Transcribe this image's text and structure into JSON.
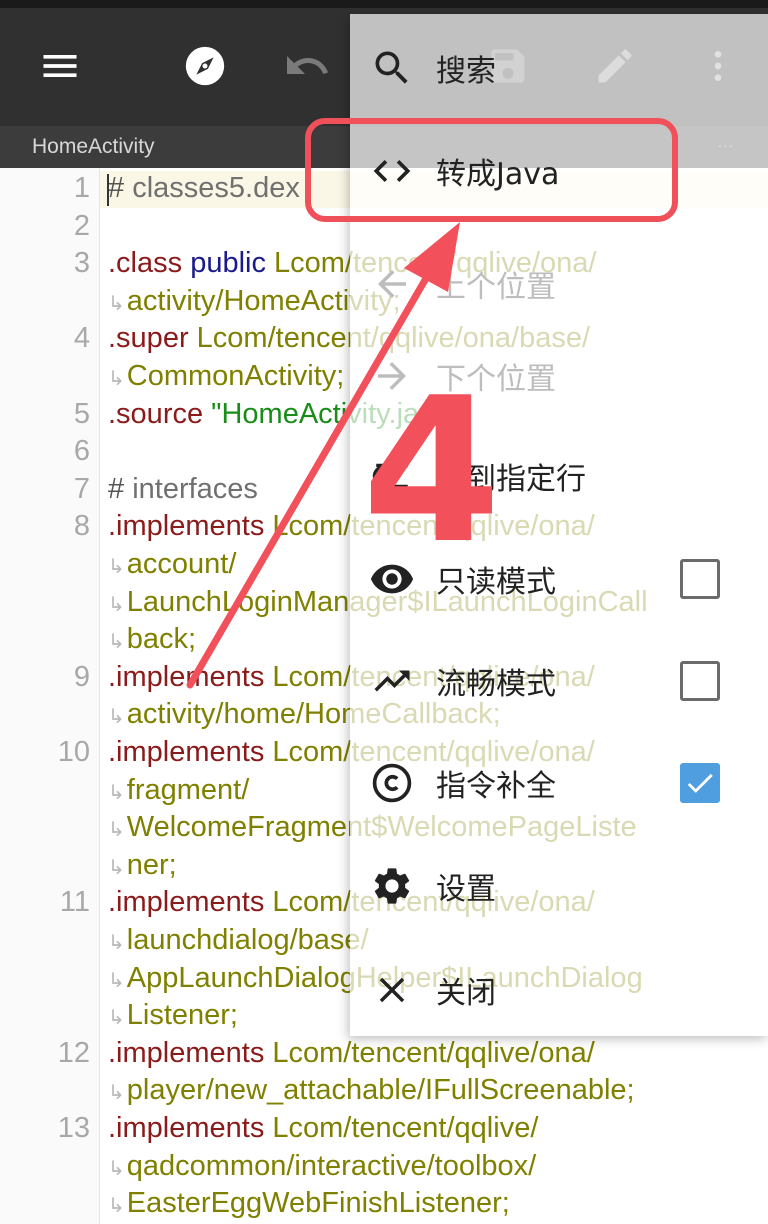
{
  "toolbar": {
    "icons": [
      "menu-icon",
      "compass-icon",
      "undo-icon",
      "save-icon",
      "edit-icon",
      "more-vert-icon"
    ]
  },
  "subbar": {
    "title": "HomeActivity",
    "dots": "..."
  },
  "editor": {
    "lines": [
      {
        "ln": "1",
        "parts": [
          {
            "t": "# ",
            "c": "#555555"
          },
          {
            "t": "classes5.dex",
            "c": "#707070"
          }
        ]
      },
      {
        "ln": "2",
        "parts": []
      },
      {
        "ln": "3",
        "parts": [
          {
            "t": ".class ",
            "c": "#8b1a1a"
          },
          {
            "t": "public ",
            "c": "#1a1a8c"
          },
          {
            "t": "Lcom/tencent/qqlive/ona/",
            "c": "#808000"
          }
        ]
      },
      {
        "ln": "",
        "wrap": true,
        "parts": [
          {
            "t": "activity/HomeActivity;",
            "c": "#808000"
          }
        ]
      },
      {
        "ln": "4",
        "parts": [
          {
            "t": ".super ",
            "c": "#8b1a1a"
          },
          {
            "t": "Lcom/tencent/qqlive/ona/base/",
            "c": "#808000"
          }
        ]
      },
      {
        "ln": "",
        "wrap": true,
        "parts": [
          {
            "t": "CommonActivity;",
            "c": "#808000"
          }
        ]
      },
      {
        "ln": "5",
        "parts": [
          {
            "t": ".source ",
            "c": "#8b1a1a"
          },
          {
            "t": "\"HomeActivity.java\"",
            "c": "#1a8c1a"
          }
        ]
      },
      {
        "ln": "6",
        "parts": []
      },
      {
        "ln": "7",
        "parts": [
          {
            "t": "# ",
            "c": "#555555"
          },
          {
            "t": "interfaces",
            "c": "#707070"
          }
        ]
      },
      {
        "ln": "8",
        "parts": [
          {
            "t": ".implements ",
            "c": "#8b1a1a"
          },
          {
            "t": "Lcom/tencent/qqlive/ona/",
            "c": "#808000"
          }
        ]
      },
      {
        "ln": "",
        "wrap": true,
        "parts": [
          {
            "t": "account/",
            "c": "#808000"
          }
        ]
      },
      {
        "ln": "",
        "wrap": true,
        "parts": [
          {
            "t": "LaunchLoginManager$ILaunchLoginCall",
            "c": "#808000"
          }
        ]
      },
      {
        "ln": "",
        "wrap": true,
        "parts": [
          {
            "t": "back;",
            "c": "#808000"
          }
        ]
      },
      {
        "ln": "9",
        "parts": [
          {
            "t": ".implements ",
            "c": "#8b1a1a"
          },
          {
            "t": "Lcom/tencent/qqlive/ona/",
            "c": "#808000"
          }
        ]
      },
      {
        "ln": "",
        "wrap": true,
        "parts": [
          {
            "t": "activity/home/HomeCallback;",
            "c": "#808000"
          }
        ]
      },
      {
        "ln": "10",
        "parts": [
          {
            "t": ".implements ",
            "c": "#8b1a1a"
          },
          {
            "t": "Lcom/tencent/qqlive/ona/",
            "c": "#808000"
          }
        ]
      },
      {
        "ln": "",
        "wrap": true,
        "parts": [
          {
            "t": "fragment/",
            "c": "#808000"
          }
        ]
      },
      {
        "ln": "",
        "wrap": true,
        "parts": [
          {
            "t": "WelcomeFragment$WelcomePageListe",
            "c": "#808000"
          }
        ]
      },
      {
        "ln": "",
        "wrap": true,
        "parts": [
          {
            "t": "ner;",
            "c": "#808000"
          }
        ]
      },
      {
        "ln": "11",
        "parts": [
          {
            "t": ".implements ",
            "c": "#8b1a1a"
          },
          {
            "t": "Lcom/tencent/qqlive/ona/",
            "c": "#808000"
          }
        ]
      },
      {
        "ln": "",
        "wrap": true,
        "parts": [
          {
            "t": "launchdialog/base/",
            "c": "#808000"
          }
        ]
      },
      {
        "ln": "",
        "wrap": true,
        "parts": [
          {
            "t": "AppLaunchDialogHelper$ILaunchDialog",
            "c": "#808000"
          }
        ]
      },
      {
        "ln": "",
        "wrap": true,
        "parts": [
          {
            "t": "Listener;",
            "c": "#808000"
          }
        ]
      },
      {
        "ln": "12",
        "parts": [
          {
            "t": ".implements ",
            "c": "#8b1a1a"
          },
          {
            "t": "Lcom/tencent/qqlive/ona/",
            "c": "#808000"
          }
        ]
      },
      {
        "ln": "",
        "wrap": true,
        "parts": [
          {
            "t": "player/new_attachable/IFullScreenable;",
            "c": "#808000"
          }
        ]
      },
      {
        "ln": "13",
        "parts": [
          {
            "t": ".implements ",
            "c": "#8b1a1a"
          },
          {
            "t": "Lcom/tencent/qqlive/",
            "c": "#808000"
          }
        ]
      },
      {
        "ln": "",
        "wrap": true,
        "parts": [
          {
            "t": "qadcommon/interactive/toolbox/",
            "c": "#808000"
          }
        ]
      },
      {
        "ln": "",
        "wrap": true,
        "parts": [
          {
            "t": "EasterEggWebFinishListener;",
            "c": "#808000"
          }
        ]
      }
    ]
  },
  "menu": {
    "items": [
      {
        "id": "search",
        "label": "搜索",
        "icon": "search-icon",
        "disabled": false
      },
      {
        "id": "to-java",
        "label": "转成Java",
        "icon": "code-icon",
        "disabled": false
      },
      {
        "id": "prev-position",
        "label": "上个位置",
        "icon": "arrow-left-icon",
        "disabled": true
      },
      {
        "id": "next-position",
        "label": "下个位置",
        "icon": "arrow-right-icon",
        "disabled": true
      },
      {
        "id": "goto-line",
        "label": "转到指定行",
        "icon": "goto-line-icon",
        "disabled": false
      },
      {
        "id": "read-only",
        "label": "只读模式",
        "icon": "eye-icon",
        "disabled": false,
        "checked": false
      },
      {
        "id": "smooth-mode",
        "label": "流畅模式",
        "icon": "trending-up-icon",
        "disabled": false,
        "checked": false
      },
      {
        "id": "autocomplete",
        "label": "指令补全",
        "icon": "copyright-icon",
        "disabled": false,
        "checked": true
      },
      {
        "id": "settings",
        "label": "设置",
        "icon": "gear-icon",
        "disabled": false
      },
      {
        "id": "close",
        "label": "关闭",
        "icon": "close-icon",
        "disabled": false
      }
    ]
  },
  "annotation": {
    "step": "4",
    "color": "#f2505a"
  }
}
